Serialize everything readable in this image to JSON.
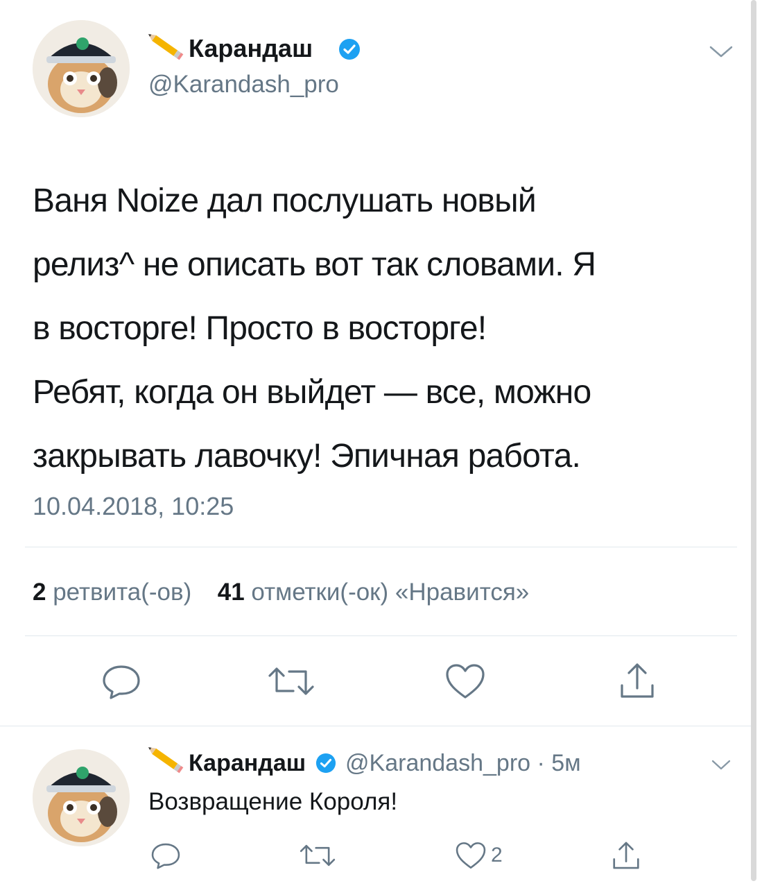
{
  "main_tweet": {
    "author_name": "Карандаш",
    "author_handle": "@Karandash_pro",
    "text_lines": [
      "Ваня Noize дал послушать новый",
      "релиз^ не описать вот так словами. Я",
      "в восторге! Просто в восторге!",
      "Ребят, когда он выйдет — все, можно",
      "закрывать лавочку! Эпичная работа."
    ],
    "timestamp": "10.04.2018, 10:25",
    "retweets_count": "2",
    "retweets_label": "ретвита(-ов)",
    "likes_count": "41",
    "likes_label": "отметки(-ок) «Нравится»",
    "icons": [
      "reply-icon",
      "retweet-icon",
      "like-icon",
      "share-icon"
    ]
  },
  "reply_tweet": {
    "author_name": "Карандаш",
    "author_handle": "@Karandash_pro",
    "time": "· 5м",
    "text": "Возвращение Короля!",
    "like_count": "2"
  },
  "colors": {
    "text": "#14171a",
    "secondary": "#657786",
    "verified": "#1da1f2",
    "divider": "#e1e8ed"
  }
}
